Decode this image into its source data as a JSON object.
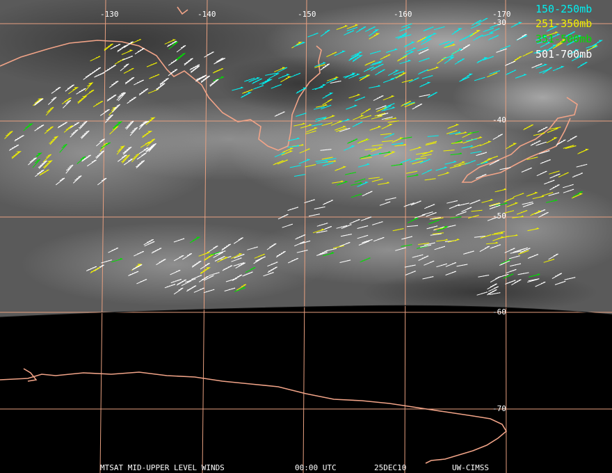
{
  "colors": {
    "grid": "#e8a080",
    "coast": "#f2a488",
    "cyan": "#00f0f0",
    "yellow": "#f0f000",
    "green": "#00e000",
    "white": "#ffffff"
  },
  "longitude_labels": [
    "-130",
    "-140",
    "-150",
    "-160",
    "-170"
  ],
  "latitude_labels": [
    "-30",
    "-40",
    "-50",
    "-60",
    "-70"
  ],
  "legend": [
    {
      "label": "150-250mb",
      "color": "#00f0f0"
    },
    {
      "label": "251-350mb",
      "color": "#f0f000"
    },
    {
      "label": "351-500mb",
      "color": "#00e000"
    },
    {
      "label": "501-700mb",
      "color": "#ffffff"
    }
  ],
  "footer": {
    "product": "MTSAT MID-UPPER LEVEL WINDS",
    "time": "00:00 UTC",
    "date": "25DEC10",
    "source": "UW-CIMSS"
  }
}
